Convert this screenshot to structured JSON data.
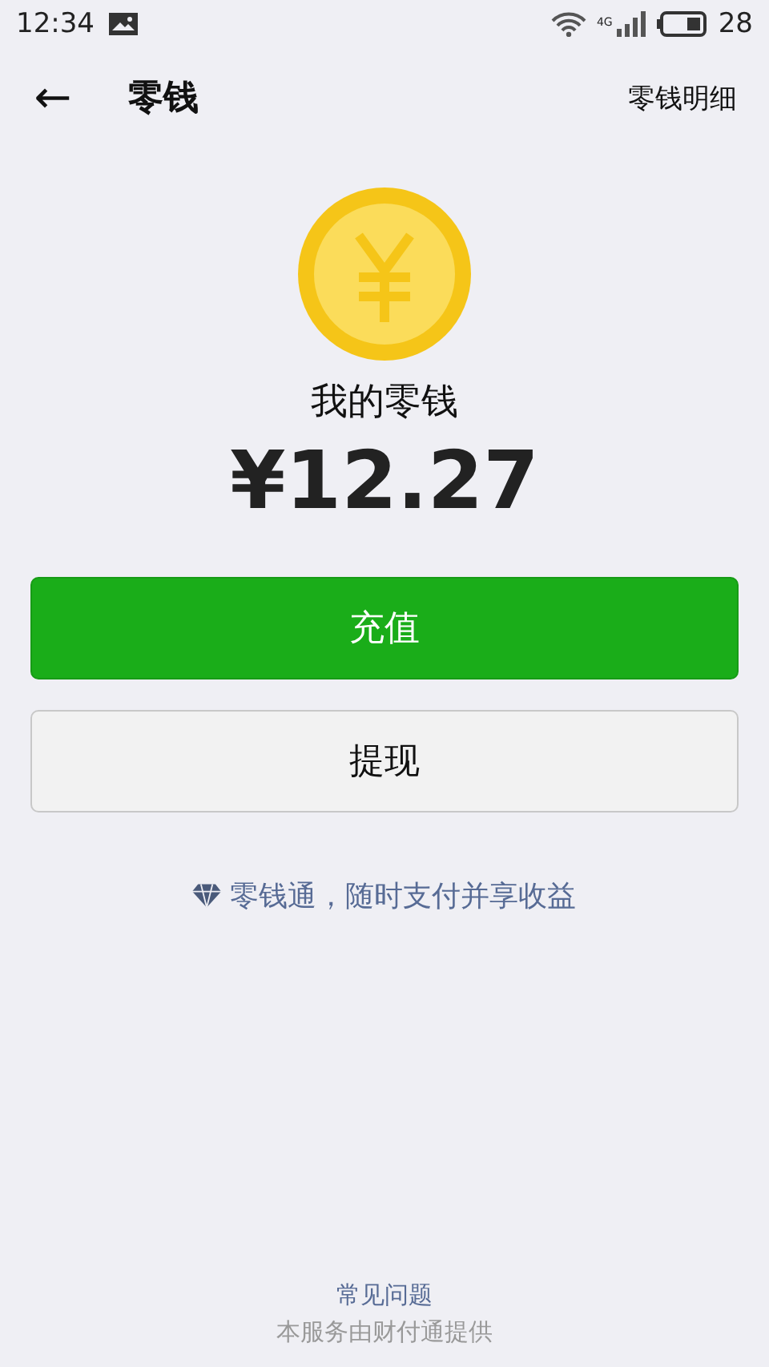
{
  "status_bar": {
    "time": "12:34",
    "network": "4G",
    "battery": "28"
  },
  "header": {
    "back_icon": "←",
    "title": "零钱",
    "action": "零钱明细"
  },
  "balance": {
    "label": "我的零钱",
    "amount": "¥12.27"
  },
  "buttons": [
    {
      "label": "充值",
      "kind": "primary"
    },
    {
      "label": "提现",
      "kind": "secondary"
    }
  ],
  "promo_link": "零钱通，随时支付并享收益",
  "footer": {
    "faq_link": "常见问题",
    "provider": "本服务由财付通提供"
  }
}
